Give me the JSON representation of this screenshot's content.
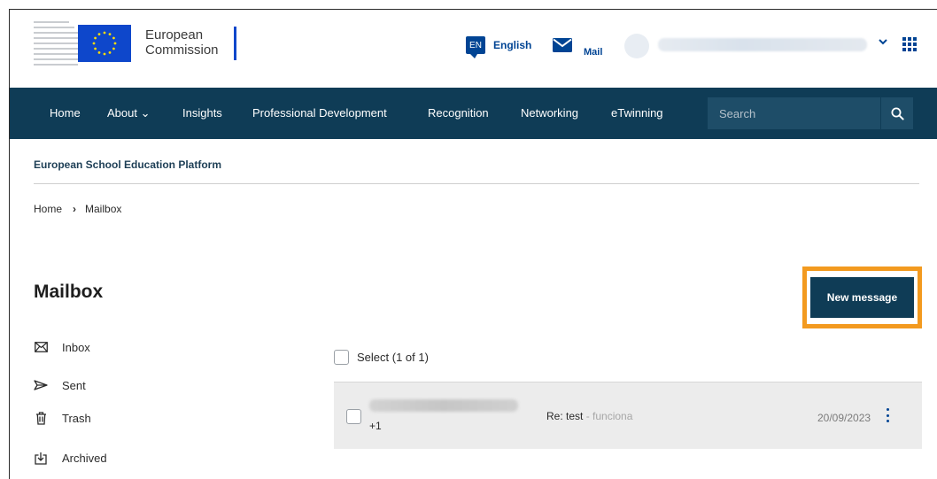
{
  "header": {
    "logo_line1": "European",
    "logo_line2": "Commission",
    "language_code": "EN",
    "language_label": "English",
    "mail_label": "Mail",
    "user_chevron": "⌄"
  },
  "nav": {
    "items": [
      {
        "label": "Home"
      },
      {
        "label": "About ⌄"
      },
      {
        "label": "Insights"
      },
      {
        "label": "Professional Development"
      },
      {
        "label": "Recognition"
      },
      {
        "label": "Networking"
      },
      {
        "label": "eTwinning"
      }
    ],
    "search_placeholder": "Search"
  },
  "platform_title": "European School Education Platform",
  "breadcrumb": {
    "home": "Home",
    "separator": "›",
    "current": "Mailbox"
  },
  "page_title": "Mailbox",
  "new_message_label": "New message",
  "sidebar": {
    "items": [
      {
        "label": "Inbox",
        "icon": "envelope-icon"
      },
      {
        "label": "Sent",
        "icon": "send-icon"
      },
      {
        "label": "Trash",
        "icon": "trash-icon"
      },
      {
        "label": "Archived",
        "icon": "archive-icon"
      }
    ]
  },
  "list": {
    "select_label": "Select (1 of 1)",
    "messages": [
      {
        "sender_extra": "+1",
        "subject": "Re: test",
        "snippet": " - funciona",
        "date": "20/09/2023"
      }
    ]
  },
  "colors": {
    "brand_navy": "#0f3c56",
    "link_blue": "#004494",
    "highlight_orange": "#f39a1f"
  }
}
